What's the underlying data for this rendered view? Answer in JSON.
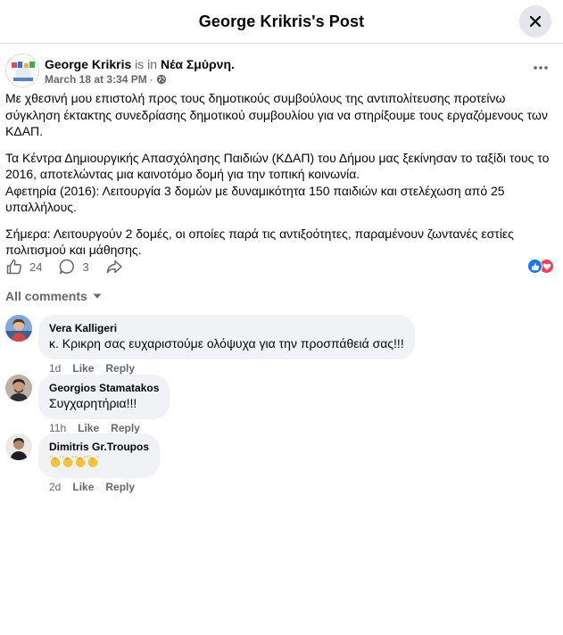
{
  "header": {
    "title": "George Krikris's Post"
  },
  "post": {
    "author": "George Krikris",
    "is_in": "is in",
    "location": "Νέα Σμύρνη.",
    "timestamp": "March 18 at 3:34 PM",
    "separator": "·",
    "paragraphs": [
      "Με χθεσινή μου επιστολή προς τους δημοτικούς συμβούλους της αντιπολίτευσης προτείνω σύγκληση έκτακτης συνεδρίασης δημοτικού συμβουλίου για να στηρίξουμε τους εργαζόμενους των ΚΔΑΠ.",
      "Τα Κέντρα Δημιουργικής Απασχόλησης Παιδιών (ΚΔΑΠ) του Δήμου μας ξεκίνησαν το ταξίδι τους το 2016, αποτελώντας μια καινοτόμο δομή για την τοπική κοινωνία.",
      "Αφετηρία (2016): Λειτουργία 3 δομών με δυναμικότητα 150 παιδιών και στελέχωση από 25 υπαλλήλους.",
      "Σήμερα: Λειτουργούν 2 δομές, οι οποίες παρά τις αντιξοότητες, παραμένουν ζωντανές εστίες πολιτισμού και μάθησης."
    ],
    "like_count": "24",
    "comment_count": "3"
  },
  "all_comments_label": "All comments",
  "comments": [
    {
      "name": "Vera Kalligeri",
      "text": "κ. Κρικρη σας ευχαριστούμε ολόψυχα για την προσπάθειά σας!!!",
      "time": "1d",
      "like": "Like",
      "reply": "Reply"
    },
    {
      "name": "Georgios Stamatakos",
      "text": "Συγχαρητήρια!!!",
      "time": "11h",
      "like": "Like",
      "reply": "Reply"
    },
    {
      "name": "Dimitris Gr.Troupos",
      "text": "",
      "time": "2d",
      "like": "Like",
      "reply": "Reply"
    }
  ],
  "colors": {
    "accent": "#1877f2",
    "love": "#f33e58",
    "muted": "#65676b",
    "bubble": "#f0f2f5"
  }
}
